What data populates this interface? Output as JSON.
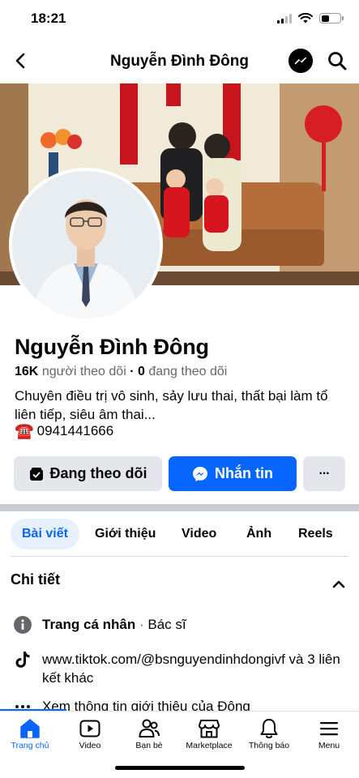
{
  "status_bar": {
    "time": "18:21"
  },
  "nav": {
    "title": "Nguyễn Đình Đông"
  },
  "profile": {
    "name": "Nguyễn Đình Đông",
    "followers_count": "16K",
    "followers_label": "người theo dõi",
    "separator": "·",
    "following_count": "0",
    "following_label": "đang theo dõi",
    "bio": "Chuyên điều trị vô sinh, sảy lưu thai, thất bại làm tổ liên tiếp, siêu âm thai...",
    "phone_icon": "☎️",
    "phone": "0941441666"
  },
  "actions": {
    "following_label": "Đang theo dõi",
    "message_label": "Nhắn tin",
    "more_label": "···"
  },
  "tabs": [
    {
      "label": "Bài viết",
      "active": true
    },
    {
      "label": "Giới thiệu",
      "active": false
    },
    {
      "label": "Video",
      "active": false
    },
    {
      "label": "Ảnh",
      "active": false
    },
    {
      "label": "Reels",
      "active": false
    }
  ],
  "details": {
    "title": "Chi tiết",
    "category_label": "Trang cá nhân",
    "category_sep": " · ",
    "category_value": "Bác sĩ",
    "links_text": "www.tiktok.com/@bsnguyendinhdongivf và 3 liên kết khác",
    "about_text": "Xem thông tin giới thiệu của Đông"
  },
  "bottom_nav": [
    {
      "label": "Trang chủ",
      "icon": "home-icon",
      "active": true
    },
    {
      "label": "Video",
      "icon": "video-icon",
      "active": false
    },
    {
      "label": "Bạn bè",
      "icon": "friends-icon",
      "active": false
    },
    {
      "label": "Marketplace",
      "icon": "marketplace-icon",
      "active": false
    },
    {
      "label": "Thông báo",
      "icon": "bell-icon",
      "active": false
    },
    {
      "label": "Menu",
      "icon": "menu-icon",
      "active": false
    }
  ],
  "colors": {
    "accent": "#0866ff",
    "button_gray": "#e4e6eb",
    "secondary_text": "#65676b"
  }
}
